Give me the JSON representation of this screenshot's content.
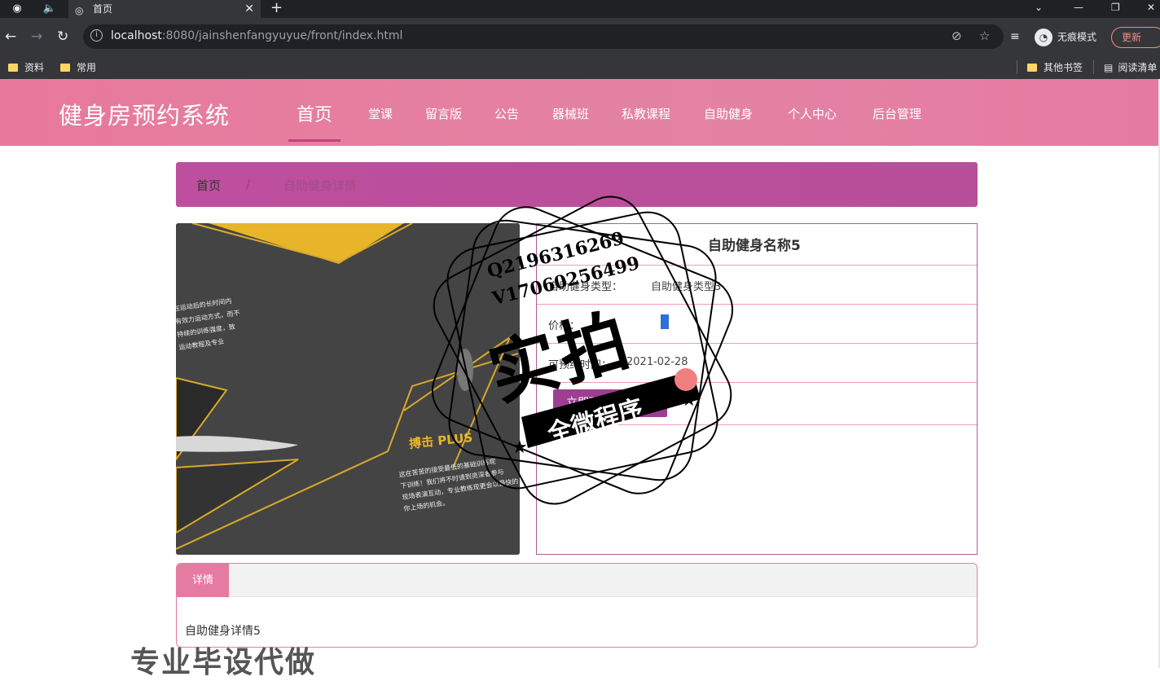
{
  "browser": {
    "tab_title": "首页",
    "url_host": "localhost",
    "url_rest": ":8080/jainshenfangyuyue/front/index.html",
    "incognito_label": "无痕模式",
    "update_label": "更新",
    "bookmarks": [
      "资料",
      "常用"
    ],
    "other_bookmarks": "其他书签",
    "reading_list": "阅读清单"
  },
  "site": {
    "logo": "健身房预约系统",
    "nav": [
      "首页",
      "堂课",
      "留言版",
      "公告",
      "器械班",
      "私教课程",
      "自助健身",
      "个人中心",
      "后台管理"
    ]
  },
  "breadcrumb": {
    "home": "首页",
    "separator": "/",
    "current": "自助健身详情"
  },
  "detail": {
    "name": "自助健身名称5",
    "type_label": "自助健身类型：",
    "type_value": "自助健身类型3",
    "price_label": "价格：",
    "time_label": "可预约时间：",
    "time_value": "2021-02-28",
    "book_button": "立即预约"
  },
  "tabs": {
    "active": "详情",
    "content": "自助健身详情5"
  },
  "poster": {
    "heading": "搏击 PLUS",
    "lines": [
      "这在苦苦的接受最低的基础训练呢",
      "下训练！我们将不时请到资深者参与",
      "现场表演互动，专业教练现更会以最快的",
      "你上场的机会。"
    ],
    "left_text": [
      "在运动后的长时间内",
      "有效力运动方式，而不",
      "持续的训练强度，致",
      "运动教程及专业"
    ]
  },
  "watermark": {
    "qq": "Q2196316269",
    "wx": "V17060256499",
    "big": "实拍",
    "ribbon": "全微程序",
    "bottom": "专业毕设代做"
  }
}
